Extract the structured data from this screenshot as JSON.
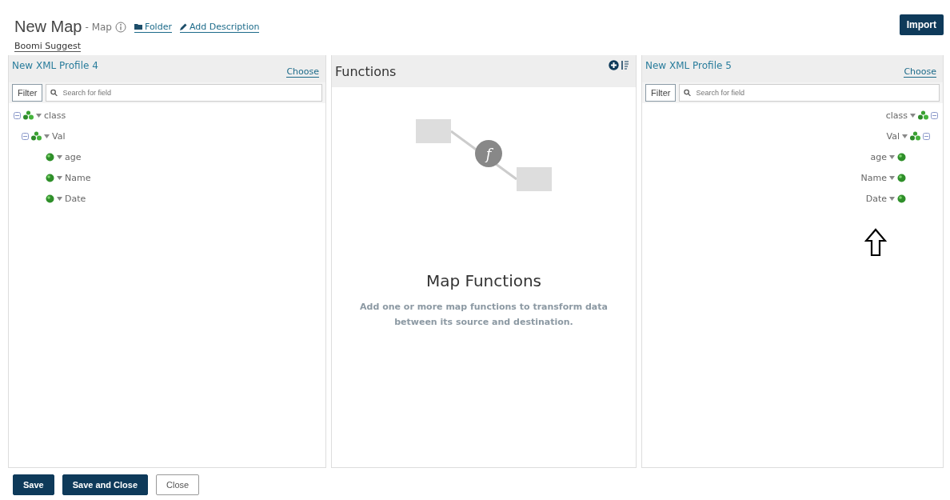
{
  "header": {
    "title": "New Map",
    "subtitle": "- Map",
    "links": [
      "Folder",
      "Add Description"
    ],
    "suggest_link": "Boomi Suggest",
    "import_button": "Import"
  },
  "source_panel": {
    "title": "New XML Profile 4",
    "choose_link": "Choose",
    "filter_button": "Filter",
    "search": {
      "placeholder": "Search for field"
    },
    "tree": [
      {
        "label": "class",
        "expanded": true,
        "children": [
          {
            "label": "Val",
            "expanded": true,
            "children": [
              {
                "label": "age"
              },
              {
                "label": "Name"
              },
              {
                "label": "Date"
              }
            ]
          }
        ]
      }
    ]
  },
  "functions_panel": {
    "title": "Functions",
    "illustration_glyph": "f",
    "empty_title": "Map Functions",
    "empty_text": "Add one or more map functions to transform data between its source and destination."
  },
  "destination_panel": {
    "title": "New XML Profile 5",
    "choose_link": "Choose",
    "filter_button": "Filter",
    "search": {
      "placeholder": "Search for field"
    },
    "tree": [
      {
        "label": "class",
        "expanded": true,
        "children": [
          {
            "label": "Val",
            "expanded": true,
            "children": [
              {
                "label": "age"
              },
              {
                "label": "Name"
              },
              {
                "label": "Date"
              }
            ]
          }
        ]
      }
    ]
  },
  "footer": {
    "buttons": [
      {
        "label": "Save",
        "kind": "primary"
      },
      {
        "label": "Save and Close",
        "kind": "primary"
      },
      {
        "label": "Close",
        "kind": "secondary"
      }
    ]
  }
}
